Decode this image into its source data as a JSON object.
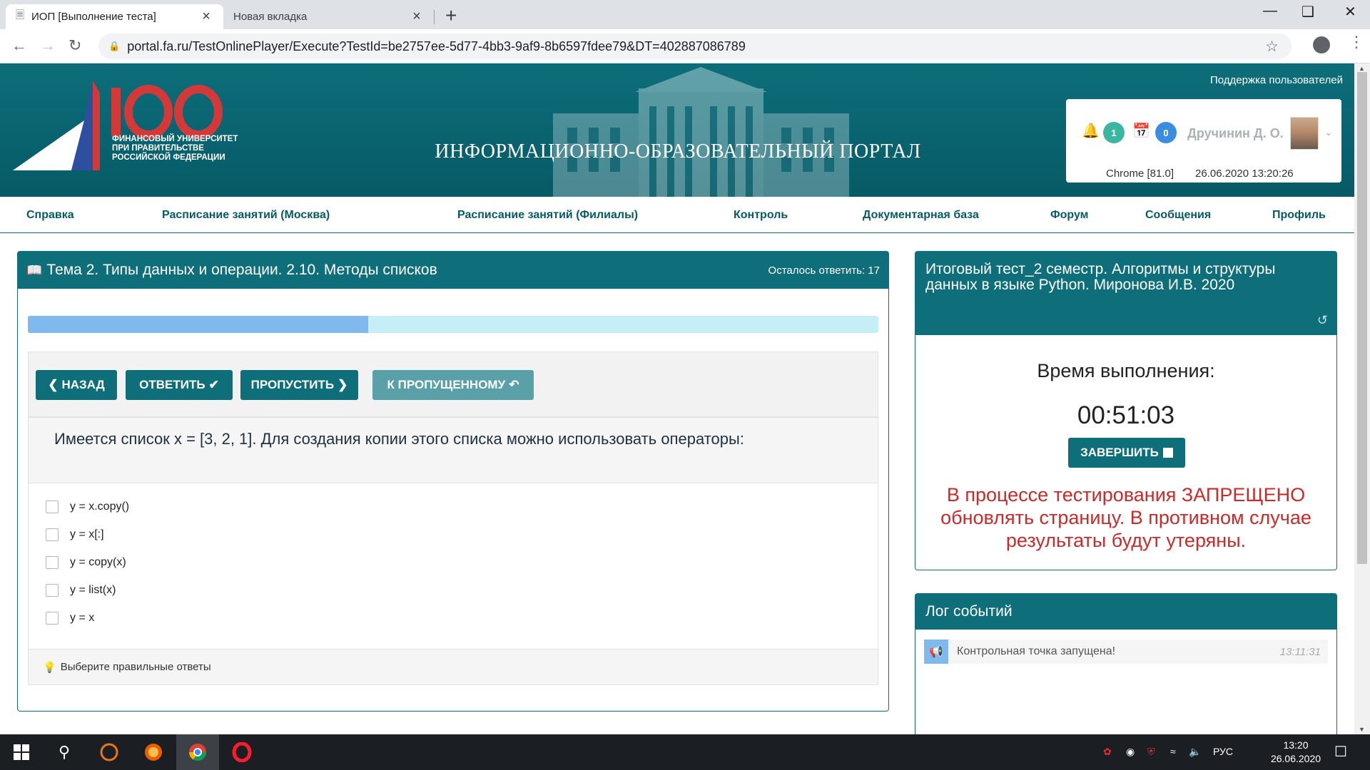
{
  "browser": {
    "tabs": [
      {
        "title": "ИОП [Выполнение теста]",
        "active": true
      },
      {
        "title": "Новая вкладка",
        "active": false
      }
    ],
    "url": "portal.fa.ru/TestOnlinePlayer/Execute?TestId=be2757ee-5d77-4bb3-9af9-8b6597fdee79&DT=402887086789"
  },
  "header": {
    "logo_number": "100",
    "logo_lines": [
      "ФИНАНСОВЫЙ УНИВЕРСИТЕТ",
      "ПРИ ПРАВИТЕЛЬСТВЕ",
      "РОССИЙСКОЙ ФЕДЕРАЦИИ"
    ],
    "portal_title": "ИНФОРМАЦИОННО-ОБРАЗОВАТЕЛЬНЫЙ ПОРТАЛ",
    "support_link": "Поддержка пользователей",
    "user": {
      "notifications": "1",
      "calendar": "0",
      "name": "Дручинин Д. О.",
      "browser": "Chrome [81.0]",
      "datetime": "26.06.2020 13:20:26"
    }
  },
  "nav": [
    "Справка",
    "Расписание занятий (Москва)",
    "Расписание занятий (Филиалы)",
    "Контроль",
    "Документарная база",
    "Форум",
    "Сообщения",
    "Профиль"
  ],
  "question_panel": {
    "title": "Тема 2. Типы данных и операции. 2.10. Методы списков",
    "remaining": "Осталось ответить: 17",
    "progress_fraction": 0.4,
    "buttons": {
      "back": "НАЗАД",
      "answer": "ОТВЕТИТЬ",
      "skip": "ПРОПУСТИТЬ",
      "to_skipped": "К ПРОПУЩЕННОМУ"
    },
    "question_text": "Имеется список x = [3, 2, 1]. Для создания копии этого списка можно использовать операторы:",
    "options": [
      "y = x.copy()",
      "y = x[:]",
      "y = copy(x)",
      "y = list(x)",
      "y = x"
    ],
    "hint": "Выберите правильные ответы"
  },
  "test_panel": {
    "title": "Итоговый тест_2 семестр. Алгоритмы и структуры данных в языке Python. Миронова И.В. 2020",
    "time_label": "Время выполнения:",
    "timer": "00:51:03",
    "finish_button": "ЗАВЕРШИТЬ",
    "warning": "В процессе тестирования ЗАПРЕЩЕНО обновлять страницу. В противном случае результаты будут утеряны."
  },
  "log_panel": {
    "title": "Лог событий",
    "entries": [
      {
        "text": "Контрольная точка запущена!",
        "time": "13:11:31"
      }
    ]
  },
  "taskbar": {
    "lang": "РУС",
    "time": "13:20",
    "date": "26.06.2020"
  },
  "colors": {
    "brand": "#0e6f7b",
    "warning": "#cc2929",
    "progress": "#7fb9ee"
  }
}
